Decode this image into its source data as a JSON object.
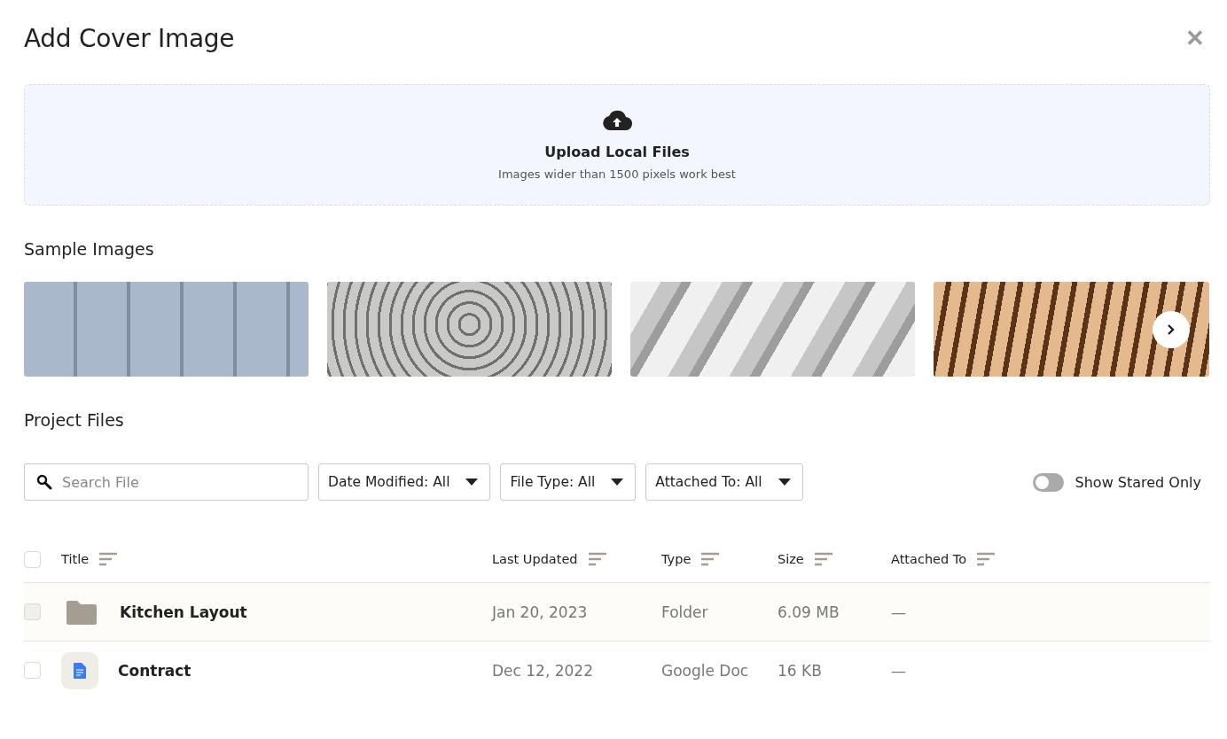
{
  "dialog": {
    "title": "Add Cover Image",
    "close": "✕"
  },
  "upload": {
    "title": "Upload Local Files",
    "hint": "Images wider than 1500 pixels work best"
  },
  "samples": {
    "heading": "Sample Images",
    "images": [
      {
        "kind": "concrete"
      },
      {
        "kind": "cobblestone"
      },
      {
        "kind": "waves"
      },
      {
        "kind": "wood"
      }
    ]
  },
  "project_files": {
    "heading": "Project Files",
    "search": {
      "placeholder": "Search File"
    },
    "filters": [
      {
        "label": "Date Modified: All"
      },
      {
        "label": "File Type: All"
      },
      {
        "label": "Attached To: All"
      }
    ],
    "toggle": {
      "label": "Show Stared Only",
      "on": false
    },
    "table": {
      "select_all": {
        "checked": false
      },
      "columns": [
        "Title",
        "Last Updated",
        "Type",
        "Size",
        "Attached To"
      ],
      "rows": [
        {
          "kind": "folder",
          "title": "Kitchen Layout",
          "last_updated": "Jan 20, 2023",
          "type": "Folder",
          "size": "6.09 MB",
          "attached_to": "—",
          "checked": false,
          "highlighted": true
        },
        {
          "kind": "doc",
          "title": "Contract",
          "last_updated": "Dec 12, 2022",
          "type": "Google Doc",
          "size": "16 KB",
          "attached_to": "—",
          "checked": false,
          "highlighted": false
        }
      ]
    }
  }
}
